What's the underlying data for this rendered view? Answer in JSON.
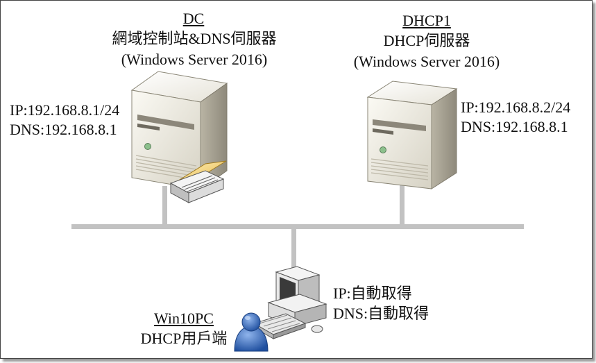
{
  "dc": {
    "name": "DC",
    "role": "網域控制站&DNS伺服器",
    "os": "(Windows  Server 2016)",
    "ip": "IP:192.168.8.1/24",
    "dns": "DNS:192.168.8.1"
  },
  "dhcp1": {
    "name": "DHCP1",
    "role": "DHCP伺服器",
    "os": "(Windows  Server 2016)",
    "ip": "IP:192.168.8.2/24",
    "dns": "DNS:192.168.8.1"
  },
  "client": {
    "name": "Win10PC",
    "role": "DHCP用戶端",
    "ip": "IP:自動取得",
    "dns": "DNS:自動取得"
  }
}
